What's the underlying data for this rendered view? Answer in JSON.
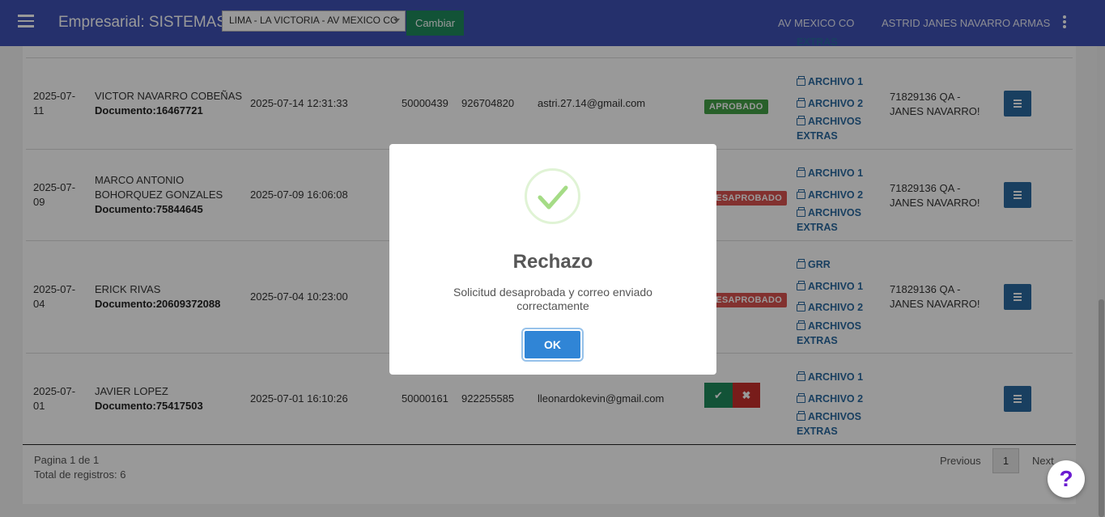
{
  "header": {
    "title": "Empresarial: SISTEMAS",
    "branch_selected": "LIMA - LA VICTORIA - AV MEXICO CO",
    "change_label": "Cambiar",
    "branch_short": "AV MEXICO CO",
    "user_name": "ASTRID JANES NAVARRO ARMAS"
  },
  "top_partial": {
    "link": "EXTRAS"
  },
  "rows": [
    {
      "date_l1": "2025-07-",
      "date_l2": "11",
      "name_l1": "VICTOR NAVARRO COBEÑAS",
      "name_l2": "",
      "document": "Documento:16467721",
      "datetime": "2025-07-14 12:31:33",
      "code": "50000439",
      "phone": "926704820",
      "email": "astri.27.14@gmail.com",
      "status": "APROBADO",
      "files": [
        "ARCHIVO 1",
        "ARCHIVO 2"
      ],
      "extras_l1": "ARCHIVOS",
      "extras_l2": "EXTRAS",
      "approver_l1": "71829136 QA -",
      "approver_l2": "JANES NAVARRO!"
    },
    {
      "date_l1": "2025-07-",
      "date_l2": "09",
      "name_l1": "MARCO ANTONIO",
      "name_l2": "BOHORQUEZ GONZALES",
      "document": "Documento:75844645",
      "datetime": "2025-07-09 16:06:08",
      "status": "DESAPROBADO",
      "files": [
        "ARCHIVO 1",
        "ARCHIVO 2"
      ],
      "extras_l1": "ARCHIVOS",
      "extras_l2": "EXTRAS",
      "approver_l1": "71829136 QA -",
      "approver_l2": "JANES NAVARRO!"
    },
    {
      "date_l1": "2025-07-",
      "date_l2": "04",
      "name_l1": "ERICK RIVAS",
      "document": "Documento:20609372088",
      "datetime": "2025-07-04 10:23:00",
      "status": "DESAPROBADO",
      "files": [
        "GRR",
        "ARCHIVO 1",
        "ARCHIVO 2"
      ],
      "extras_l1": "ARCHIVOS",
      "extras_l2": "EXTRAS",
      "approver_l1": "71829136 QA -",
      "approver_l2": "JANES NAVARRO!"
    },
    {
      "date_l1": "2025-07-",
      "date_l2": "01",
      "name_l1": "JAVIER LOPEZ",
      "document": "Documento:75417503",
      "datetime": "2025-07-01 16:10:26",
      "code": "50000161",
      "phone": "922255585",
      "email": "lleonardokevin@gmail.com",
      "files": [
        "ARCHIVO 1",
        "ARCHIVO 2"
      ],
      "extras_l1": "ARCHIVOS",
      "extras_l2": "EXTRAS"
    }
  ],
  "pagination": {
    "page_info": "Pagina 1 de 1",
    "total": "Total de registros: 6",
    "previous": "Previous",
    "current": "1",
    "next": "Next"
  },
  "modal": {
    "title": "Rechazo",
    "message": "Solicitud desaprobada y correo enviado correctamente",
    "ok_label": "OK"
  },
  "help": {
    "label": "?"
  },
  "colors": {
    "primary": "#3f51b5",
    "success": "#1e8a5c",
    "danger": "#d9534f",
    "link": "#2a6aa0",
    "ok_button": "#3085d6"
  }
}
